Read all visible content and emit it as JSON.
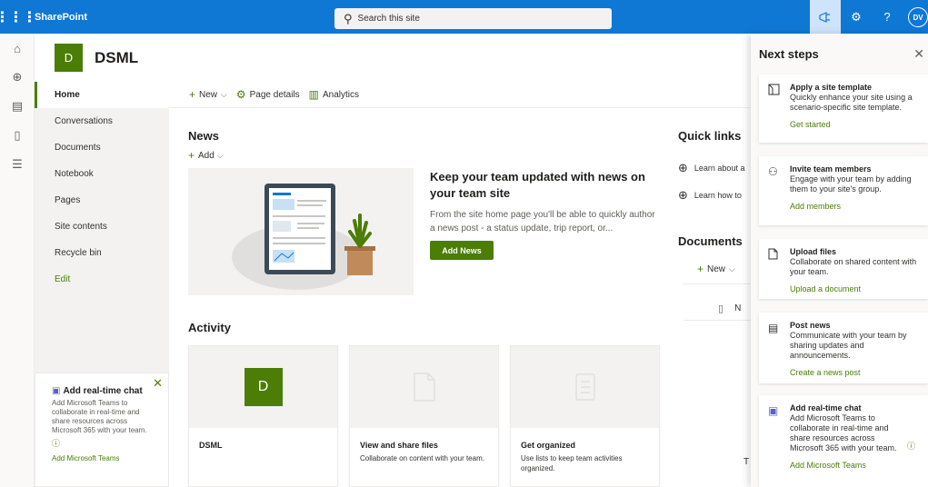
{
  "suite_bar": {
    "brand": "SharePoint",
    "search_placeholder": "Search this site",
    "avatar_initials": "DV"
  },
  "site": {
    "logo_letter": "D",
    "title": "DSML"
  },
  "left_nav": {
    "items": [
      {
        "label": "Home",
        "selected": true
      },
      {
        "label": "Conversations"
      },
      {
        "label": "Documents"
      },
      {
        "label": "Notebook"
      },
      {
        "label": "Pages"
      },
      {
        "label": "Site contents"
      },
      {
        "label": "Recycle bin"
      },
      {
        "label": "Edit"
      }
    ],
    "teams_promo": {
      "title": "Add real-time chat",
      "description": "Add Microsoft Teams to collaborate in real-time and share resources across Microsoft 365 with your team.",
      "link": "Add Microsoft Teams"
    }
  },
  "command_bar": {
    "new_label": "New",
    "page_details_label": "Page details",
    "analytics_label": "Analytics"
  },
  "news": {
    "title": "News",
    "add_label": "Add",
    "headline": "Keep your team updated with news on your team site",
    "description": "From the site home page you'll be able to quickly author a news post - a status update, trip report, or...",
    "button_label": "Add News"
  },
  "activity": {
    "title": "Activity",
    "cards": [
      {
        "title": "DSML",
        "description": "",
        "thumb_letter": "D"
      },
      {
        "title": "View and share files",
        "description": "Collaborate on content with your team."
      },
      {
        "title": "Get organized",
        "description": "Use lists to keep team activities organized."
      }
    ]
  },
  "quick_links": {
    "title": "Quick links",
    "items": [
      "Learn about a",
      "Learn how to"
    ]
  },
  "documents": {
    "title": "Documents",
    "new_label": "New",
    "column_initial": "N",
    "trailing_char": "T"
  },
  "next_steps": {
    "title": "Next steps",
    "cards": [
      {
        "title": "Apply a site template",
        "description": "Quickly enhance your site using a scenario-specific site template.",
        "link": "Get started"
      },
      {
        "title": "Invite team members",
        "description": "Engage with your team by adding them to your site's group.",
        "link": "Add members"
      },
      {
        "title": "Upload files",
        "description": "Collaborate on shared content with your team.",
        "link": "Upload a document"
      },
      {
        "title": "Post news",
        "description": "Communicate with your team by sharing updates and announcements.",
        "link": "Create a news post"
      },
      {
        "title": "Add real-time chat",
        "description": "Add Microsoft Teams to collaborate in real-time and share resources across Microsoft 365 with your team.",
        "link": "Add Microsoft Teams"
      }
    ]
  },
  "icons": {
    "app_launcher": "waffle-icon",
    "megaphone": "megaphone-icon",
    "settings": "gear-icon",
    "help": "help-icon"
  },
  "colors": {
    "suite_bar": "#0f78d4",
    "site_accent": "#4b7d07",
    "teams_purple": "#5b5fc7"
  }
}
